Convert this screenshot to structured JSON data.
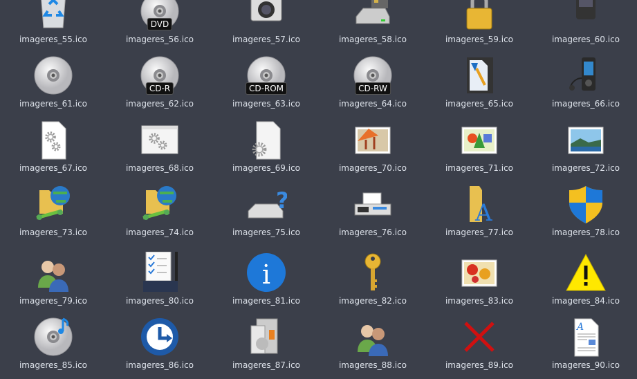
{
  "files": [
    {
      "name": "imageres_55.ico",
      "icon": "recycle-bin"
    },
    {
      "name": "imageres_56.ico",
      "icon": "disc",
      "badge": "DVD"
    },
    {
      "name": "imageres_57.ico",
      "icon": "camera"
    },
    {
      "name": "imageres_58.ico",
      "icon": "card-drive"
    },
    {
      "name": "imageres_59.ico",
      "icon": "lock"
    },
    {
      "name": "imageres_60.ico",
      "icon": "phone"
    },
    {
      "name": "imageres_61.ico",
      "icon": "disc"
    },
    {
      "name": "imageres_62.ico",
      "icon": "disc",
      "badge": "CD-R"
    },
    {
      "name": "imageres_63.ico",
      "icon": "disc",
      "badge": "CD-ROM"
    },
    {
      "name": "imageres_64.ico",
      "icon": "disc",
      "badge": "CD-RW"
    },
    {
      "name": "imageres_65.ico",
      "icon": "memory-card"
    },
    {
      "name": "imageres_66.ico",
      "icon": "media-player"
    },
    {
      "name": "imageres_67.ico",
      "icon": "doc-gear"
    },
    {
      "name": "imageres_68.ico",
      "icon": "window-gear"
    },
    {
      "name": "imageres_69.ico",
      "icon": "file-gear"
    },
    {
      "name": "imageres_70.ico",
      "icon": "picture-paint"
    },
    {
      "name": "imageres_71.ico",
      "icon": "picture-shapes"
    },
    {
      "name": "imageres_72.ico",
      "icon": "picture-landscape"
    },
    {
      "name": "imageres_73.ico",
      "icon": "network-folder"
    },
    {
      "name": "imageres_74.ico",
      "icon": "network-folder"
    },
    {
      "name": "imageres_75.ico",
      "icon": "drive-question"
    },
    {
      "name": "imageres_76.ico",
      "icon": "fax"
    },
    {
      "name": "imageres_77.ico",
      "icon": "font-folder"
    },
    {
      "name": "imageres_78.ico",
      "icon": "shield"
    },
    {
      "name": "imageres_79.ico",
      "icon": "users"
    },
    {
      "name": "imageres_80.ico",
      "icon": "checklist"
    },
    {
      "name": "imageres_81.ico",
      "icon": "info"
    },
    {
      "name": "imageres_82.ico",
      "icon": "key"
    },
    {
      "name": "imageres_83.ico",
      "icon": "picture-flowers"
    },
    {
      "name": "imageres_84.ico",
      "icon": "warning"
    },
    {
      "name": "imageres_85.ico",
      "icon": "disc-music"
    },
    {
      "name": "imageres_86.ico",
      "icon": "backup"
    },
    {
      "name": "imageres_87.ico",
      "icon": "software-box"
    },
    {
      "name": "imageres_88.ico",
      "icon": "users"
    },
    {
      "name": "imageres_89.ico",
      "icon": "error-x"
    },
    {
      "name": "imageres_90.ico",
      "icon": "document"
    }
  ]
}
